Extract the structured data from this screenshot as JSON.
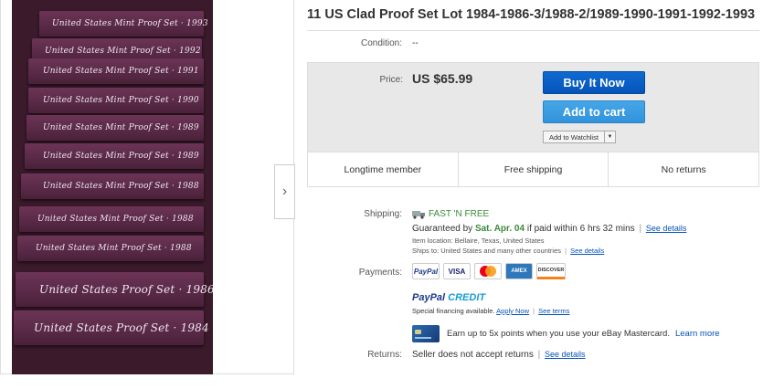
{
  "gallery": {
    "boxes": [
      "United States Mint Proof Set · 1993",
      "United States Mint Proof Set · 1992",
      "United States Mint Proof Set · 1991",
      "United States Mint Proof Set · 1990",
      "United States Mint Proof Set · 1989",
      "United States Mint Proof Set · 1989",
      "United States Mint Proof Set · 1988",
      "United States Mint Proof Set · 1988",
      "United States Mint Proof Set · 1988",
      "United States Proof Set · 1986",
      "United States Proof Set · 1984"
    ],
    "next_icon": "chevron-right-icon",
    "next_glyph": "›"
  },
  "listing": {
    "title": "11 US Clad Proof Set Lot 1984-1986-3/1988-2/1989-1990-1991-1992-1993",
    "condition_label": "Condition:",
    "condition_value": "--",
    "price_label": "Price:",
    "price_value": "US $65.99",
    "buy_now_label": "Buy It Now",
    "add_to_cart_label": "Add to cart",
    "watchlist_label": "Add to Watchlist",
    "watchlist_dropdown_glyph": "▼",
    "badges": [
      "Longtime member",
      "Free shipping",
      "No returns"
    ]
  },
  "shipping": {
    "label": "Shipping:",
    "fast_free": "FAST 'N FREE",
    "guaranteed_prefix": "Guaranteed by",
    "guaranteed_date": "Sat. Apr. 04",
    "guaranteed_suffix": "if paid within 6 hrs 32 mins",
    "see_details": "See details",
    "item_location": "Item location:  Bellaire, Texas, United States",
    "ships_to": "Ships to:  United States and many other countries",
    "ships_see_details": "See details"
  },
  "payments": {
    "label": "Payments:",
    "methods": [
      "PayPal",
      "VISA",
      "MasterCard",
      "AMEX",
      "DISCOVER"
    ],
    "paypal_credit_a": "PayPal",
    "paypal_credit_b": "CREDIT",
    "financing_text": "Special financing available.",
    "apply_now": "Apply Now",
    "see_terms": "See terms",
    "mastercard_text": "Earn up to 5x points when you use your eBay Mastercard.",
    "learn_more": "Learn more"
  },
  "returns": {
    "label": "Returns:",
    "text": "Seller does not accept returns",
    "see_details": "See details"
  },
  "colors": {
    "buy_now": "#0654ba",
    "add_to_cart": "#3293dc",
    "green": "#3a8a3a",
    "link": "#0654ba",
    "box_purple": "#5a2a48"
  }
}
